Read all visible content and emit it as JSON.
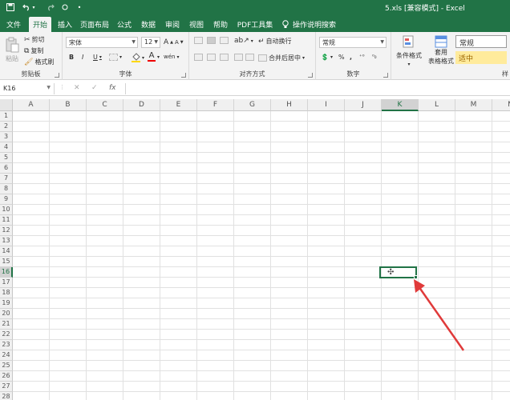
{
  "titlebar": {
    "save_icon": "save-icon",
    "undo_icon": "undo-icon",
    "redo_icon": "redo-icon",
    "doc_title": "5.xls  [兼容模式]  -  Excel"
  },
  "tabs": [
    {
      "label": "文件",
      "active": false
    },
    {
      "label": "开始",
      "active": true
    },
    {
      "label": "插入",
      "active": false
    },
    {
      "label": "页面布局",
      "active": false
    },
    {
      "label": "公式",
      "active": false
    },
    {
      "label": "数据",
      "active": false
    },
    {
      "label": "审阅",
      "active": false
    },
    {
      "label": "视图",
      "active": false
    },
    {
      "label": "帮助",
      "active": false
    },
    {
      "label": "PDF工具集",
      "active": false
    }
  ],
  "tell_me": "操作说明搜索",
  "clipboard": {
    "paste": "粘贴",
    "cut": "剪切",
    "copy": "复制",
    "format_painter": "格式刷",
    "group": "剪贴板"
  },
  "font": {
    "font_name": "宋体",
    "font_size": "12",
    "grow": "A",
    "shrink": "A",
    "bold": "B",
    "italic": "I",
    "underline": "U",
    "font_color_letter": "A",
    "phonetic": "wén",
    "group": "字体"
  },
  "alignment": {
    "wrap_text": "自动换行",
    "merge_center": "合并后居中",
    "group": "对齐方式"
  },
  "number": {
    "format": "常规",
    "percent": "%",
    "comma": ",",
    "group": "数字"
  },
  "styles": {
    "conditional_formatting": "条件格式",
    "format_as_table_line1": "套用",
    "format_as_table_line2": "表格格式",
    "style_normal": "常规",
    "style_neutral": "适中",
    "group_partial": "样"
  },
  "formula_bar": {
    "name_box": "K16",
    "cancel": "✕",
    "enter": "✓",
    "fx": "fx",
    "value": ""
  },
  "sheet": {
    "columns": [
      "A",
      "B",
      "C",
      "D",
      "E",
      "F",
      "G",
      "H",
      "I",
      "J",
      "K",
      "L",
      "M",
      "N"
    ],
    "rows": [
      "1",
      "2",
      "3",
      "4",
      "5",
      "6",
      "7",
      "8",
      "9",
      "10",
      "11",
      "12",
      "13",
      "14",
      "15",
      "16",
      "17",
      "18",
      "19",
      "20",
      "21",
      "22",
      "23",
      "24",
      "25",
      "26",
      "27",
      "28"
    ],
    "selected_column": "K",
    "selected_row": "16"
  },
  "colors": {
    "brand": "#217346",
    "annotation_arrow": "#e03a3a"
  }
}
